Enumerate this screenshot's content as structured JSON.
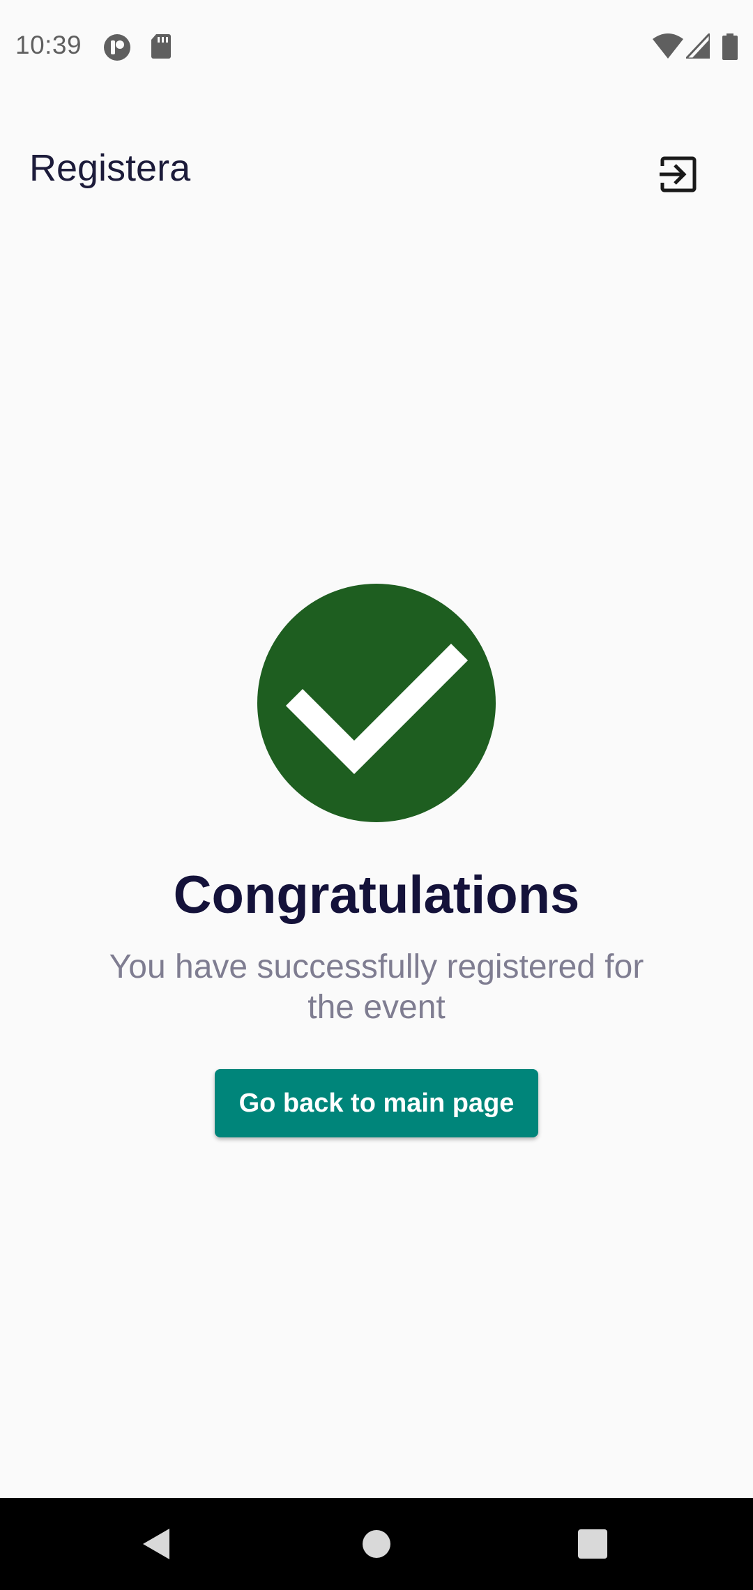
{
  "status_bar": {
    "time": "10:39",
    "left_icons": [
      "app-notification-icon",
      "sd-card-icon"
    ],
    "right_icons": [
      "wifi-icon",
      "cellular-signal-icon",
      "battery-icon"
    ]
  },
  "app_bar": {
    "title": "Registera",
    "action_icon": "logout-icon"
  },
  "success": {
    "icon": "check-icon",
    "icon_bg_color": "#1e5e20",
    "headline": "Congratulations",
    "message": "You have successfully registered for the event",
    "button_label": "Go back to main page",
    "button_color": "#00857a"
  },
  "nav_bar": {
    "buttons": [
      "back-icon",
      "home-icon",
      "recents-icon"
    ]
  }
}
